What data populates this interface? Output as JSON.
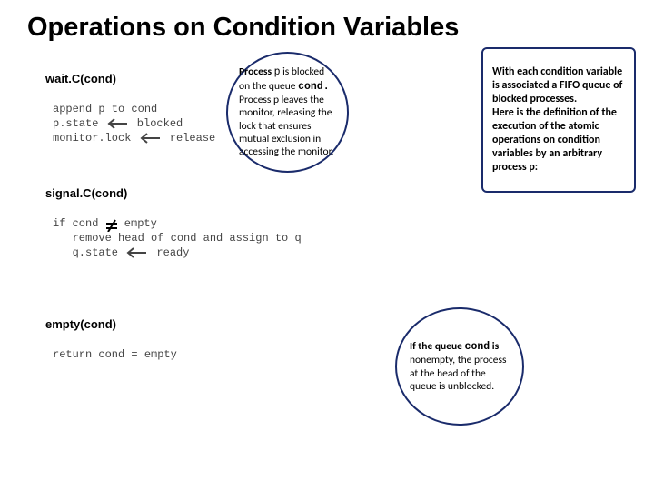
{
  "title": "Operations on Condition Variables",
  "waitC": {
    "header": "wait.C(cond)",
    "l1": "append p to cond",
    "l2a": "p.state ",
    "l2b": " blocked",
    "l3a": "monitor.lock ",
    "l3b": " release"
  },
  "signalC": {
    "header": "signal.C(cond)",
    "l1a": "if cond ",
    "l1b": " empty",
    "l2": "   remove head of cond and assign to q",
    "l3a": "   q.state ",
    "l3b": " ready"
  },
  "emptyC": {
    "header": "empty(cond)",
    "l1": "return cond = empty"
  },
  "callout1": {
    "strong1": "Process ",
    "p": "p",
    "mid1": " is blocked on the queue ",
    "cond": "cond.",
    "rest": " Process p leaves the monitor, releasing the lock that ensures mutual exclusion in accessing the monitor."
  },
  "callout2": {
    "text": "With each condition variable is associated a FIFO queue of blocked processes.\nHere is the definition of the execution of the atomic operations on condition variables by an arbitrary process p:"
  },
  "callout3": {
    "strong": "If the queue ",
    "cond": "cond",
    "mid": " is ",
    "rest": "nonempty, the process at the head of the queue is unblocked."
  }
}
